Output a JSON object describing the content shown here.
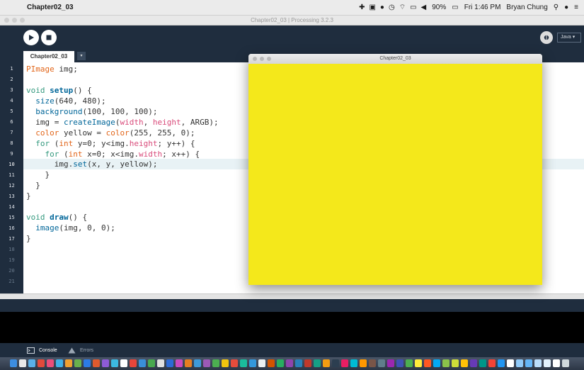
{
  "menubar": {
    "app_name": "Chapter02_03",
    "battery": "90%",
    "clock": "Fri 1:46 PM",
    "user": "Bryan Chung"
  },
  "ide": {
    "window_title": "Chapter02_03 | Processing 3.2.3",
    "mode": "Java ▾",
    "tab_name": "Chapter02_03",
    "tab_menu": "▾",
    "line_numbers": [
      "1",
      "2",
      "3",
      "4",
      "5",
      "6",
      "7",
      "8",
      "9",
      "10",
      "11",
      "12",
      "13",
      "14",
      "15",
      "16",
      "17",
      "18",
      "19",
      "20",
      "21"
    ],
    "current_line": "10"
  },
  "code": {
    "l1": {
      "a": "PImage",
      "b": " img;"
    },
    "l3": {
      "a": "void",
      "b": " ",
      "c": "setup",
      "d": "() {"
    },
    "l4": {
      "a": "  ",
      "b": "size",
      "c": "(640, 480);"
    },
    "l5": {
      "a": "  ",
      "b": "background",
      "c": "(100, 100, 100);"
    },
    "l6": {
      "a": "  img = ",
      "b": "createImage",
      "c": "(",
      "d": "width",
      "e": ", ",
      "f": "height",
      "g": ", ARGB);"
    },
    "l7": {
      "a": "  ",
      "b": "color",
      "c": " yellow = ",
      "d": "color",
      "e": "(255, 255, 0);"
    },
    "l8": {
      "a": "  ",
      "b": "for",
      "c": " (",
      "d": "int",
      "e": " y=0; y<img.",
      "f": "height",
      "g": "; y++) {"
    },
    "l9": {
      "a": "    ",
      "b": "for",
      "c": " (",
      "d": "int",
      "e": " x=0; x<img.",
      "f": "width",
      "g": "; x++) {"
    },
    "l10": {
      "a": "      img.",
      "b": "set",
      "c": "(x, y, yellow);"
    },
    "l11": "    }",
    "l12": "  }",
    "l13": "}",
    "l15": {
      "a": "void",
      "b": " ",
      "c": "draw",
      "d": "() {"
    },
    "l16": {
      "a": "  ",
      "b": "image",
      "c": "(img, 0, 0);"
    },
    "l17": "}"
  },
  "console": {
    "console_tab": "Console",
    "errors_tab": "Errors"
  },
  "sketch": {
    "title": "Chapter02_03",
    "fill_color": "#f4e81b"
  },
  "colors": {
    "pde_dark": "#1f2d3e",
    "keyword": "#33997e",
    "function": "#006699",
    "builtin": "#e2661a",
    "variable": "#d94a7a"
  },
  "dock_colors": [
    "#3c8de0",
    "#e9e9e9",
    "#5ab0e8",
    "#e24a3b",
    "#e94e7b",
    "#3fb0e8",
    "#f0a030",
    "#6ab04c",
    "#2c7be5",
    "#e05a2e",
    "#8d5bd6",
    "#3cb9e2",
    "#ffffff",
    "#e8463a",
    "#3a8fd8",
    "#48a94f",
    "#e0e0e0",
    "#2d6ad6",
    "#c94ac0",
    "#e67e22",
    "#3d9ad9",
    "#9b59b6",
    "#4caf50",
    "#f1c40f",
    "#e74c3c",
    "#1abc9c",
    "#3498db",
    "#ecf0f1",
    "#d35400",
    "#27ae60",
    "#8e44ad",
    "#2980b9",
    "#c0392b",
    "#16a085",
    "#f39c12",
    "#2c3e50",
    "#e91e63",
    "#00bcd4",
    "#ff9800",
    "#795548",
    "#607d8b",
    "#9c27b0",
    "#3f51b5",
    "#4caf50",
    "#ffeb3b",
    "#ff5722",
    "#03a9f4",
    "#8bc34a",
    "#cddc39",
    "#ffc107",
    "#673ab7",
    "#009688",
    "#f44336",
    "#2196f3",
    "#ffffff",
    "#90caf9",
    "#64b5f6",
    "#bbdefb",
    "#e3f2fd",
    "#ffffff",
    "#cfd8dc"
  ]
}
